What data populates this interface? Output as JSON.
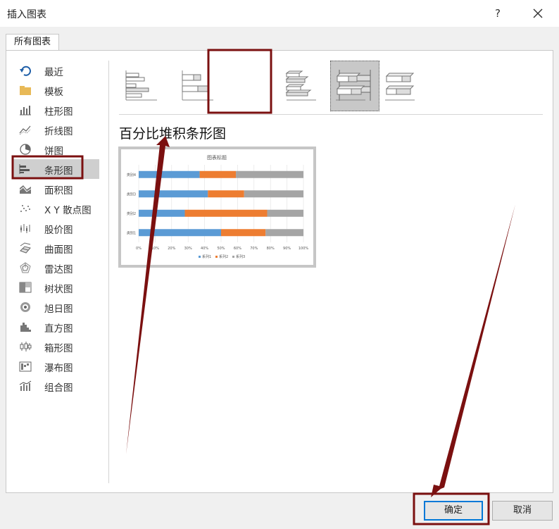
{
  "dialog": {
    "title": "插入图表",
    "help": "?",
    "tab": "所有图表",
    "ok_label": "确定",
    "cancel_label": "取消"
  },
  "categories": [
    {
      "label": "最近",
      "icon": "recent-icon"
    },
    {
      "label": "模板",
      "icon": "folder-icon"
    },
    {
      "label": "柱形图",
      "icon": "column-chart-icon"
    },
    {
      "label": "折线图",
      "icon": "line-chart-icon"
    },
    {
      "label": "饼图",
      "icon": "pie-chart-icon"
    },
    {
      "label": "条形图",
      "icon": "bar-chart-icon",
      "selected": true
    },
    {
      "label": "面积图",
      "icon": "area-chart-icon"
    },
    {
      "label": "X Y 散点图",
      "icon": "scatter-chart-icon"
    },
    {
      "label": "股价图",
      "icon": "stock-chart-icon"
    },
    {
      "label": "曲面图",
      "icon": "surface-chart-icon"
    },
    {
      "label": "雷达图",
      "icon": "radar-chart-icon"
    },
    {
      "label": "树状图",
      "icon": "treemap-chart-icon"
    },
    {
      "label": "旭日图",
      "icon": "sunburst-chart-icon"
    },
    {
      "label": "直方图",
      "icon": "histogram-chart-icon"
    },
    {
      "label": "箱形图",
      "icon": "boxplot-chart-icon"
    },
    {
      "label": "瀑布图",
      "icon": "waterfall-chart-icon"
    },
    {
      "label": "组合图",
      "icon": "combo-chart-icon"
    }
  ],
  "subtypes": [
    {
      "icon": "clustered-bar-icon"
    },
    {
      "icon": "stacked-bar-icon"
    },
    {
      "icon": "percent-stacked-bar-icon",
      "selected": true
    },
    {
      "icon": "3d-clustered-bar-icon"
    },
    {
      "icon": "3d-stacked-bar-icon"
    },
    {
      "icon": "3d-percent-stacked-bar-icon"
    }
  ],
  "selected_subtype_title": "百分比堆积条形图",
  "chart_data": {
    "type": "bar",
    "orientation": "horizontal",
    "stacking": "percent",
    "title": "图表标题",
    "categories": [
      "类别1",
      "类别2",
      "类别3",
      "类别4"
    ],
    "series": [
      {
        "name": "系列1",
        "values": [
          50,
          28,
          42,
          37
        ],
        "color": "#5b9bd5"
      },
      {
        "name": "系列2",
        "values": [
          27,
          50,
          22,
          22
        ],
        "color": "#ed7d31"
      },
      {
        "name": "系列3",
        "values": [
          23,
          22,
          36,
          41
        ],
        "color": "#a5a5a5"
      }
    ],
    "xlim": [
      0,
      100
    ],
    "xticks": [
      "0%",
      "10%",
      "20%",
      "30%",
      "40%",
      "50%",
      "60%",
      "70%",
      "80%",
      "90%",
      "100%"
    ],
    "grid": true,
    "legend": "bottom"
  },
  "colors": {
    "highlight": "#7b1010",
    "ok_focus": "#0078d7"
  }
}
